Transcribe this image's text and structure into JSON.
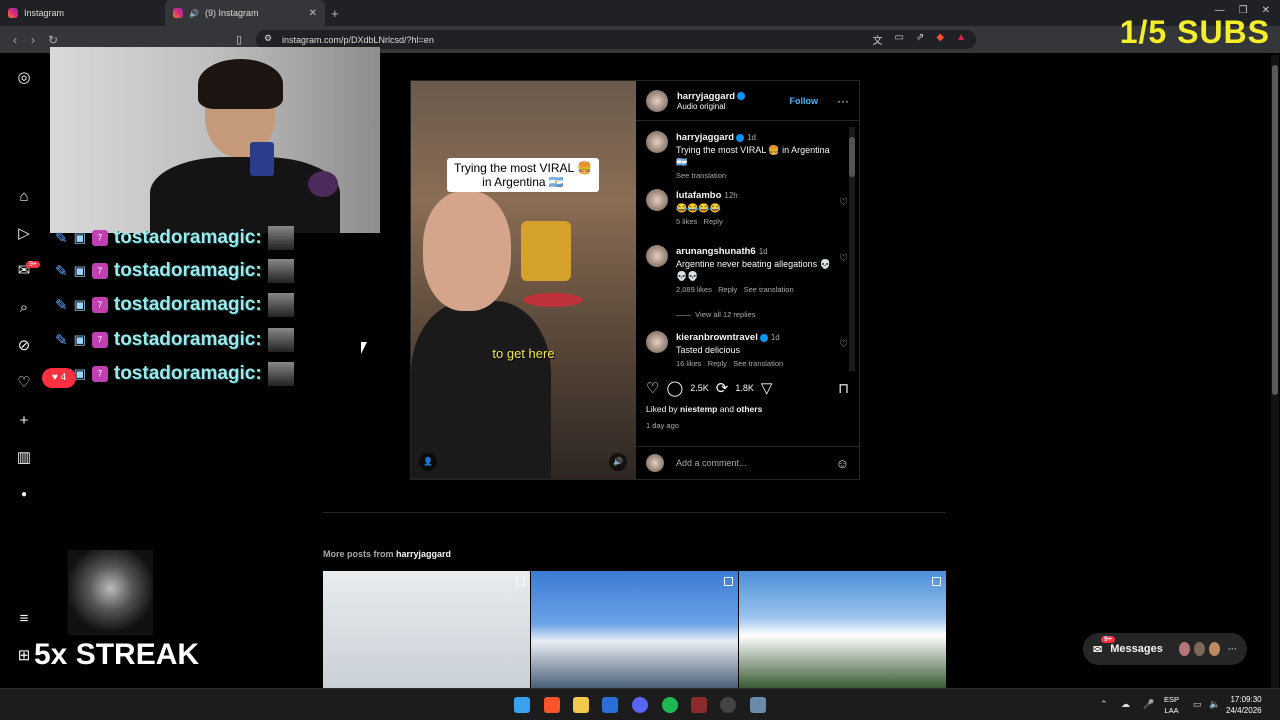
{
  "browser": {
    "tabs": [
      {
        "label": "Instagram"
      },
      {
        "label": "(9) Instagram"
      }
    ],
    "new_tab": "+",
    "url": "instagram.com/p/DXdbLNrlcsd/?hl=en"
  },
  "overlay": {
    "subs": "1/5 SUBS",
    "streak": "5x STREAK",
    "chat_user": "tostadoramagic:",
    "heart_count": "4"
  },
  "sidebar": {
    "notifications_badge": "9+"
  },
  "post": {
    "author": "harryjaggard",
    "audio": "Audio original",
    "follow_label": "Follow",
    "media_caption_line1": "Trying the most VIRAL 🍔",
    "media_caption_line2": "in Argentina 🇦🇷",
    "media_subtitle": "to get here",
    "comments": [
      {
        "user": "harryjaggard",
        "time": "1d",
        "text": "Trying the most VIRAL 🍔 in Argentina 🇦🇷",
        "meta": "See translation"
      },
      {
        "user": "lutafambo",
        "time": "12h",
        "text": "😂😂😂😂",
        "likes": "5 likes",
        "reply": "Reply"
      },
      {
        "user": "arunangshunath6",
        "time": "1d",
        "text": "Argentine never beating allegations 💀💀💀",
        "likes": "2,089 likes",
        "reply": "Reply",
        "translate": "See translation"
      },
      {
        "user": "kieranbrowntravel",
        "time": "1d",
        "text": "Tasted delicious",
        "likes": "16 likes",
        "reply": "Reply",
        "translate": "See translation"
      }
    ],
    "view_replies": "View all 12 replies",
    "comment_count": "2.5K",
    "share_count": "1.8K",
    "liked_by_prefix": "Liked by",
    "liked_by_user": "niestemp",
    "liked_by_and": "and",
    "liked_by_others": "others",
    "date": "1 day ago",
    "add_comment_placeholder": "Add a comment..."
  },
  "more_posts": {
    "prefix": "More posts from",
    "user": "harryjaggard"
  },
  "messages": {
    "label": "Messages",
    "badge": "9+"
  },
  "taskbar": {
    "lang_line1": "ESP",
    "lang_line2": "LAA",
    "time": "17:09:30",
    "date": "24/4/2026"
  }
}
